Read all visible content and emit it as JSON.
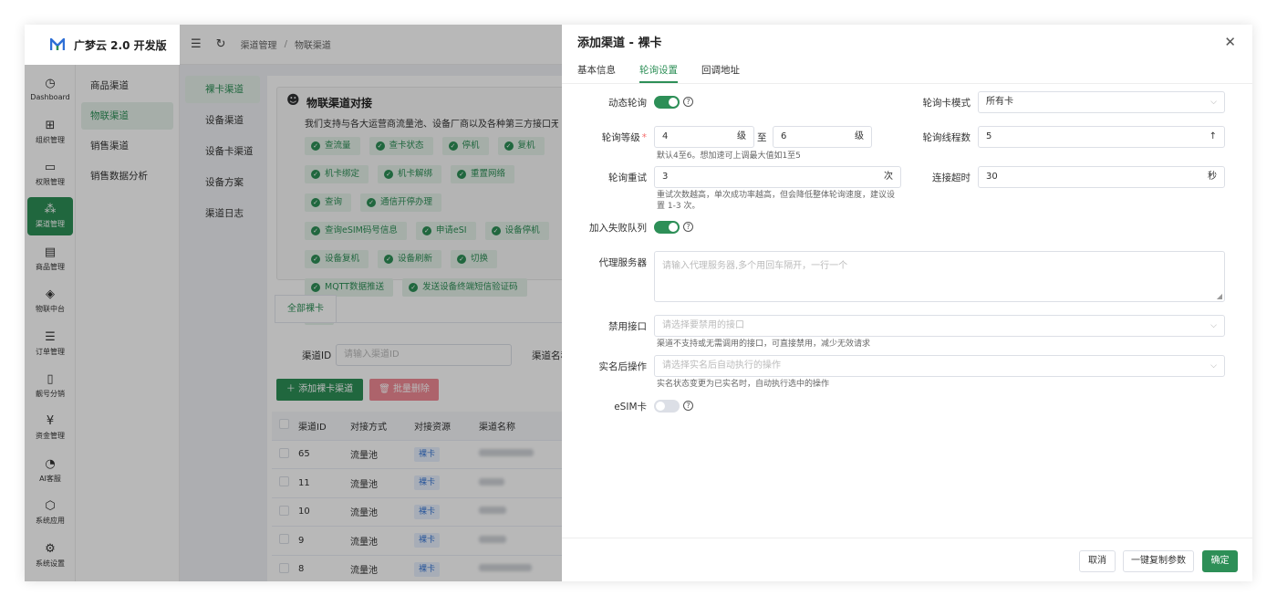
{
  "app": {
    "name": "广梦云 2.0 开发版"
  },
  "rail": [
    {
      "label": "Dashboard",
      "icon": "◷"
    },
    {
      "label": "组织管理",
      "icon": "⊞"
    },
    {
      "label": "权限管理",
      "icon": "▭"
    },
    {
      "label": "渠道管理",
      "icon": "⁂"
    },
    {
      "label": "商品管理",
      "icon": "▤"
    },
    {
      "label": "物联中台",
      "icon": "◈"
    },
    {
      "label": "订单管理",
      "icon": "☰"
    },
    {
      "label": "靓号分销",
      "icon": "▯"
    },
    {
      "label": "资金管理",
      "icon": "¥"
    },
    {
      "label": "AI客服",
      "icon": "◔"
    },
    {
      "label": "系统应用",
      "icon": "⬡"
    },
    {
      "label": "系统设置",
      "icon": "⚙"
    }
  ],
  "submenu": [
    "商品渠道",
    "物联渠道",
    "销售渠道",
    "销售数据分析"
  ],
  "breadcrumb": [
    "渠道管理",
    "/",
    "物联渠道"
  ],
  "channel_nav": [
    "裸卡渠道",
    "设备渠道",
    "设备卡渠道",
    "设备方案",
    "渠道日志"
  ],
  "banner": {
    "title": "物联渠道对接",
    "desc": "我们支持与各大运营商流量池、设备厂商以及各种第三方接口无缝",
    "chips": [
      "查流量",
      "查卡状态",
      "停机",
      "复机",
      "机卡绑定",
      "机卡解绑",
      "重置网络",
      "查询",
      "通信开停办理",
      "查询eSIM码号信息",
      "申请eSI",
      "设备停机",
      "设备复机",
      "设备刷新",
      "切换",
      "MQTT数据推送",
      "发送设备终端短信验证码",
      ""
    ]
  },
  "list": {
    "tab": "全部裸卡",
    "filter_label": "渠道ID",
    "filter_placeholder": "请输入渠道ID",
    "filter2_label": "渠道名称",
    "add_button": "添加裸卡渠道",
    "delete_button": "批量删除",
    "columns": [
      "渠道ID",
      "对接方式",
      "对接资源",
      "渠道名称"
    ],
    "rows": [
      {
        "id": "65",
        "method": "流量池",
        "resource": "裸卡"
      },
      {
        "id": "11",
        "method": "流量池",
        "resource": "裸卡"
      },
      {
        "id": "10",
        "method": "流量池",
        "resource": "裸卡"
      },
      {
        "id": "9",
        "method": "流量池",
        "resource": "裸卡"
      },
      {
        "id": "8",
        "method": "流量池",
        "resource": "裸卡"
      }
    ]
  },
  "drawer": {
    "title": "添加渠道 - 裸卡",
    "tabs": [
      "基本信息",
      "轮询设置",
      "回调地址"
    ],
    "active_tab": 1,
    "fields": {
      "dynamic_poll": {
        "label": "动态轮询",
        "on": true
      },
      "poll_mode": {
        "label": "轮询卡模式",
        "value": "所有卡"
      },
      "poll_level": {
        "label": "轮询等级",
        "from": "4",
        "to": "6",
        "unit": "级",
        "sep": "至",
        "hint": "默认4至6。想加速可上调最大值如1至5"
      },
      "poll_threads": {
        "label": "轮询线程数",
        "value": "5"
      },
      "poll_retry": {
        "label": "轮询重试",
        "value": "3",
        "unit": "次",
        "hint": "重试次数越高，单次成功率越高，但会降低整体轮询速度，建议设置 1-3 次。"
      },
      "conn_timeout": {
        "label": "连接超时",
        "value": "30",
        "unit": "秒"
      },
      "fail_queue": {
        "label": "加入失败队列",
        "on": true
      },
      "proxy": {
        "label": "代理服务器",
        "placeholder": "请输入代理服务器,多个用回车隔开，一行一个"
      },
      "disabled_api": {
        "label": "禁用接口",
        "placeholder": "请选择要禁用的接口",
        "hint": "渠道不支持或无需调用的接口，可直接禁用，减少无效请求"
      },
      "after_realname": {
        "label": "实名后操作",
        "placeholder": "请选择实名后自动执行的操作",
        "hint": "实名状态变更为已实名时，自动执行选中的操作"
      },
      "esim": {
        "label": "eSIM卡",
        "on": false
      }
    },
    "footer": {
      "cancel": "取消",
      "copy": "一键复制参数",
      "confirm": "确定"
    }
  },
  "colors": {
    "primary": "#2d8f57",
    "danger": "#f08a95",
    "tag": "#3a78d6"
  }
}
